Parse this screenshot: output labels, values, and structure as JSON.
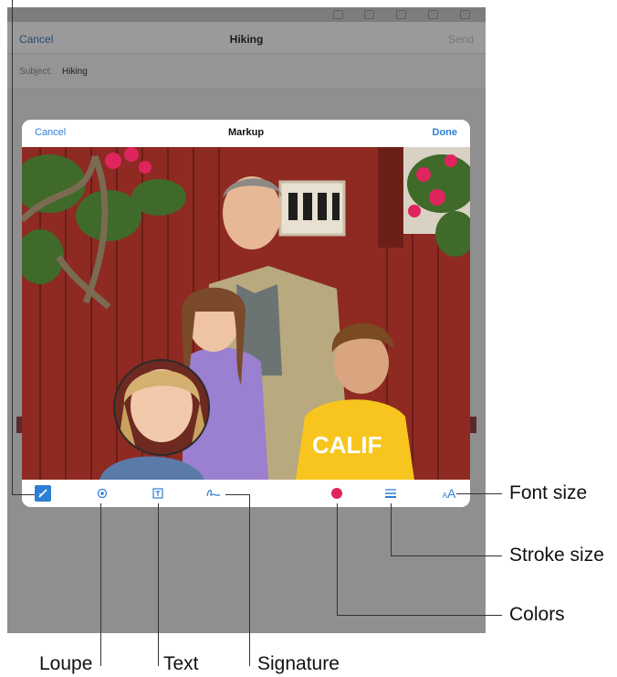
{
  "mail": {
    "cancel": "Cancel",
    "title": "Hiking",
    "send": "Send",
    "subject_label": "Subject:",
    "subject_value": "Hiking"
  },
  "markup": {
    "cancel": "Cancel",
    "title": "Markup",
    "done": "Done"
  },
  "toolbar": {
    "font_size_small": "A",
    "font_size_big": "A",
    "color_dot": "#e0245e"
  },
  "callouts": {
    "font_size": "Font size",
    "stroke_size": "Stroke size",
    "colors": "Colors",
    "loupe": "Loupe",
    "text": "Text",
    "signature": "Signature"
  },
  "photo": {
    "shirt_text": "CALIF"
  },
  "colors": {
    "accent": "#2f7fd4",
    "dimmed_background": "#8f8f8f",
    "barn_red": "#8e2a22"
  }
}
